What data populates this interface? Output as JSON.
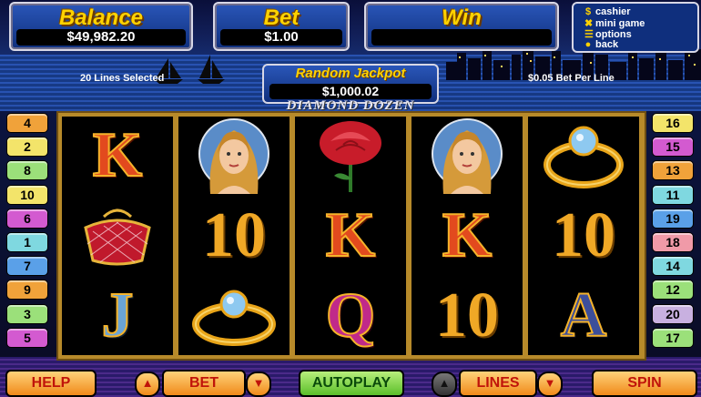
{
  "header": {
    "balance_label": "Balance",
    "balance_value": "$49,982.20",
    "bet_label": "Bet",
    "bet_value": "$1.00",
    "win_label": "Win",
    "win_value": ""
  },
  "menu": {
    "items": [
      "cashier",
      "mini game",
      "options",
      "back"
    ],
    "icons": [
      "cashier-icon",
      "mini-game-icon",
      "options-icon",
      "back-icon"
    ]
  },
  "info": {
    "lines_selected": "20 Lines Selected",
    "bet_per_line": "$0.05 Bet Per Line"
  },
  "jackpot": {
    "label": "Random Jackpot",
    "value": "$1,000.02"
  },
  "logo_text": "DIAMOND DOZEN",
  "reels": [
    [
      "K",
      "purse",
      "J"
    ],
    [
      "woman",
      "10",
      "ring"
    ],
    [
      "rose",
      "K",
      "Q"
    ],
    [
      "woman",
      "K",
      "10"
    ],
    [
      "ring",
      "10",
      "A"
    ]
  ],
  "left_lines": [
    "4",
    "2",
    "8",
    "10",
    "6",
    "1",
    "7",
    "9",
    "3",
    "5"
  ],
  "right_lines": [
    "16",
    "15",
    "13",
    "11",
    "19",
    "18",
    "14",
    "12",
    "20",
    "17"
  ],
  "line_colors": {
    "left": [
      "#f0a23a",
      "#f3e46a",
      "#9be07a",
      "#f3e46a",
      "#d35ad0",
      "#7fd8e0",
      "#5aa0e8",
      "#f0a23a",
      "#9be07a",
      "#d35ad0"
    ],
    "right": [
      "#f3e46a",
      "#d35ad0",
      "#f0a23a",
      "#7fd8e0",
      "#5aa0e8",
      "#f09aa8",
      "#7fd8e0",
      "#9be07a",
      "#c8b0e0",
      "#9be07a"
    ]
  },
  "controls": {
    "help": "HELP",
    "bet": "BET",
    "autoplay": "AUTOPLAY",
    "lines": "LINES",
    "spin": "SPIN"
  },
  "colors": {
    "title_gold": "#ffd200",
    "frame_gold": "#b78a2a",
    "panel_blue": "#0f2f7d"
  }
}
